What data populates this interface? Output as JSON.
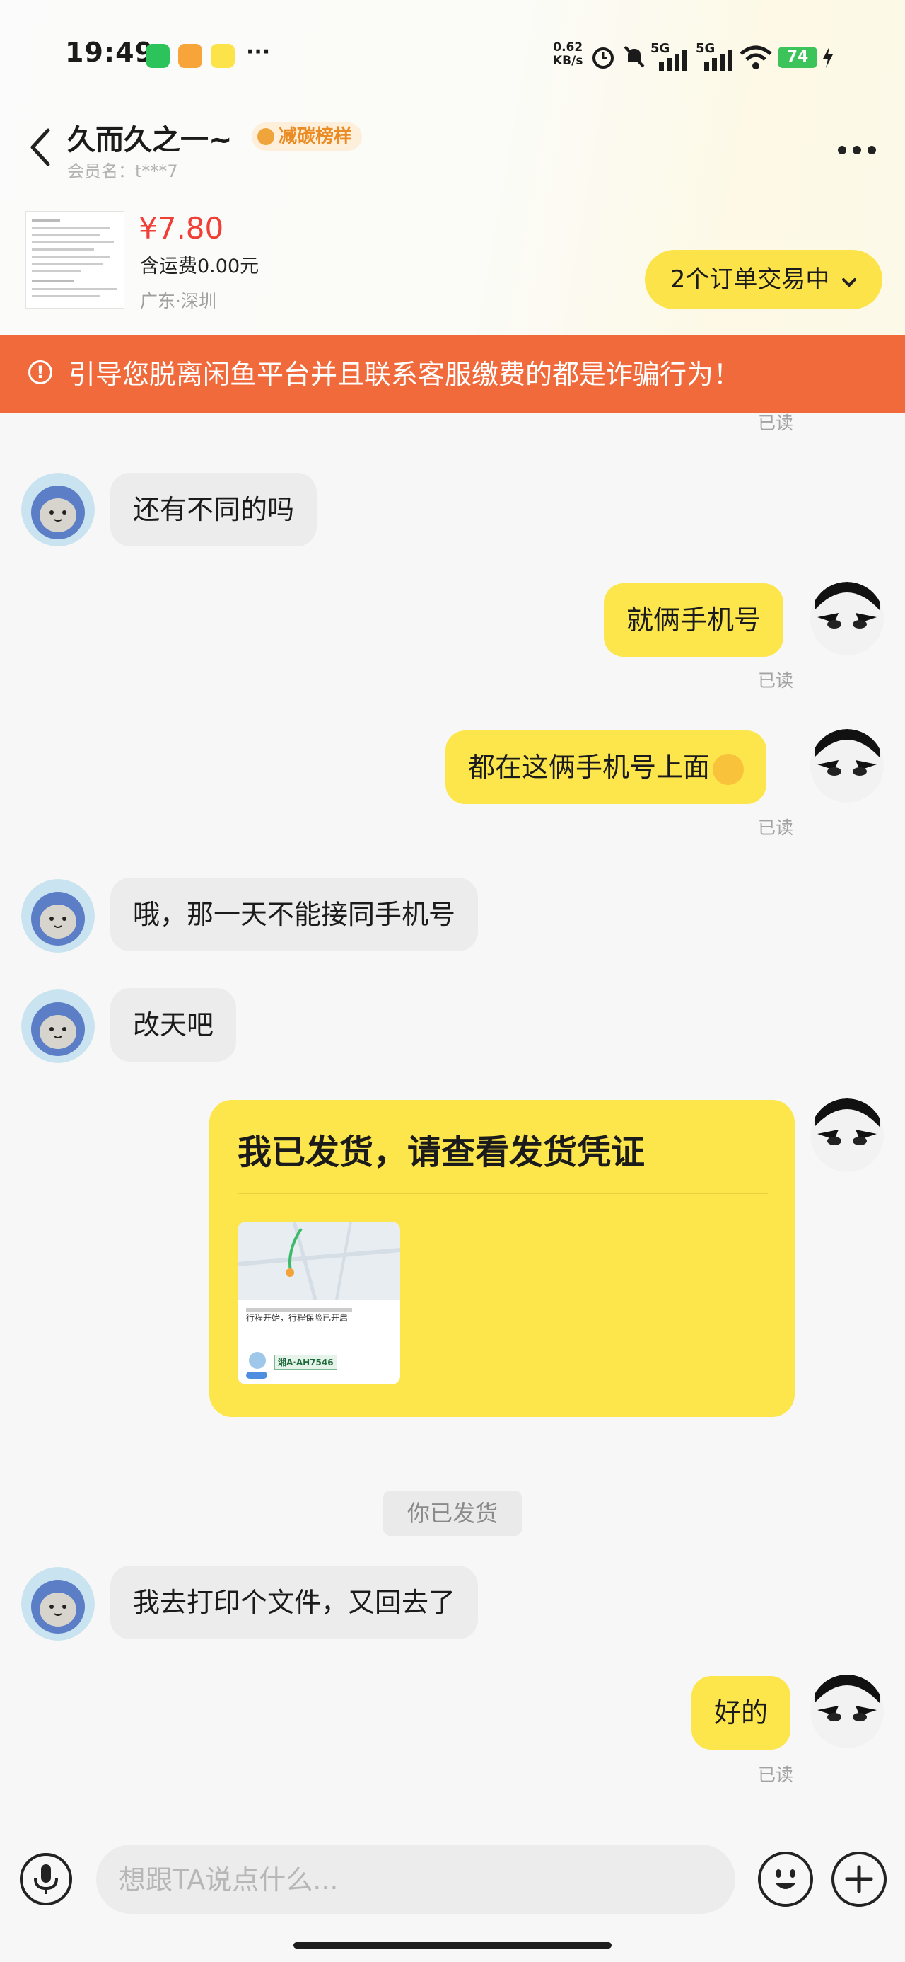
{
  "status_bar": {
    "time": "19:49",
    "speed_value": "0.62",
    "speed_unit": "KB/s",
    "net1": "5G",
    "net2": "5G",
    "battery": "74",
    "more": "···"
  },
  "header": {
    "nickname": "久而久之一~",
    "badge": "减碳榜样",
    "member": "会员名：t***7"
  },
  "product": {
    "price": "¥7.80",
    "shipping": "含运费0.00元",
    "location": "广东·深圳",
    "orders_label": "2个订单交易中"
  },
  "warning": "引导您脱离闲鱼平台并且联系客服缴费的都是诈骗行为！",
  "messages": {
    "top_read": "已读",
    "m1": "还有不同的吗",
    "m2": "就俩手机号",
    "m2_read": "已读",
    "m3": "都在这俩手机号上面",
    "m3_read": "已读",
    "m4": "哦，那一天不能接同手机号",
    "m5": "改天吧",
    "card_title": "我已发货，请查看发货凭证",
    "card_img_text": "行程开始，行程保险已开启",
    "card_plate": "湘A·AH7546",
    "system_note": "你已发货",
    "m6": "我去打印个文件，又回去了",
    "m7": "好的",
    "m7_read": "已读"
  },
  "input": {
    "placeholder": "想跟TA说点什么..."
  },
  "colors": {
    "accent_yellow": "#fce64c",
    "warning_bg": "#f06a3c",
    "price_red": "#ef3f36"
  }
}
